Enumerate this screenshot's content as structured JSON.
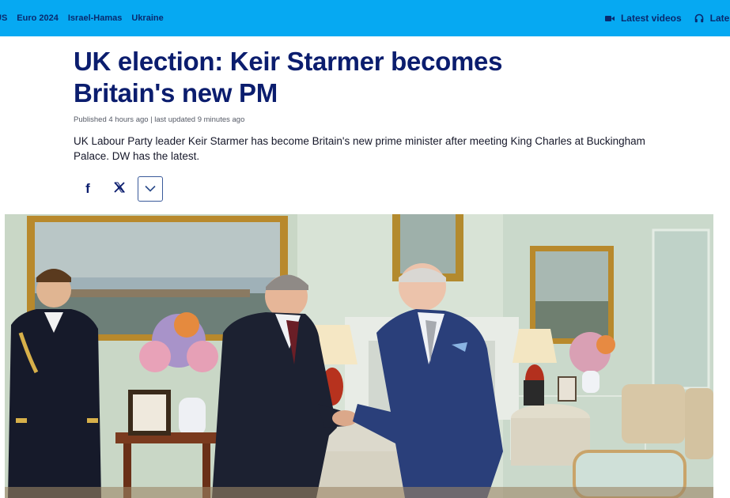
{
  "top_nav": {
    "partial_item": "US",
    "items": [
      "Euro 2024",
      "Israel-Hamas",
      "Ukraine"
    ],
    "right": {
      "latest_videos": "Latest videos",
      "latest_audio": "Latest"
    }
  },
  "article": {
    "headline_line1": "UK election: Keir Starmer becomes",
    "headline_line2": "Britain's new PM",
    "meta": "Published 4 hours ago | last updated 9 minutes ago",
    "lead": "UK Labour Party leader Keir Starmer has become Britain's new prime minister after meeting King Charles at Buckingham Palace. DW has the latest."
  },
  "share": {
    "facebook_glyph": "f",
    "x_glyph": "𝕏"
  },
  "colors": {
    "topbar": "#06a9f2",
    "nav_text": "#0a2a6e",
    "headline": "#0b1d6e"
  },
  "icons": [
    "video-camera-icon",
    "headphones-icon",
    "facebook-icon",
    "x-icon",
    "chevron-down-icon"
  ]
}
